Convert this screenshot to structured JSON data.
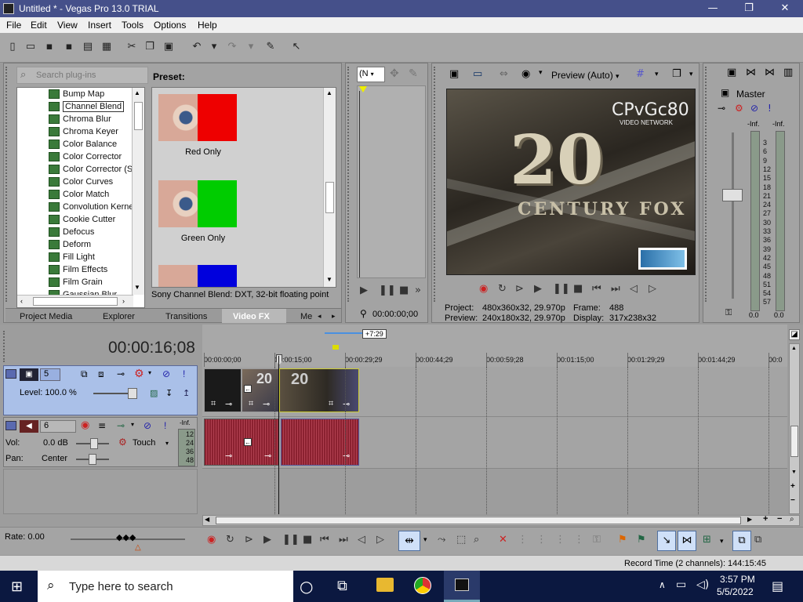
{
  "window": {
    "title": "Untitled * - Vegas Pro 13.0 TRIAL",
    "minimize": "—",
    "restore": "❐",
    "close": "✕"
  },
  "menu": [
    "File",
    "Edit",
    "View",
    "Insert",
    "Tools",
    "Options",
    "Help"
  ],
  "plugins": {
    "search_placeholder": "Search plug-ins",
    "items": [
      "Bump Map",
      "Channel Blend",
      "Chroma Blur",
      "Chroma Keyer",
      "Color Balance",
      "Color Corrector",
      "Color Corrector (S",
      "Color Curves",
      "Color Match",
      "Convolution Kerne",
      "Cookie Cutter",
      "Defocus",
      "Deform",
      "Fill Light",
      "Film Effects",
      "Film Grain",
      "Gaussian Blur"
    ],
    "selected_index": 1
  },
  "preset": {
    "header": "Preset:",
    "items": [
      "Red Only",
      "Green Only"
    ],
    "status": "Sony Channel Blend: DXT, 32-bit floating point"
  },
  "tabs": [
    "Project Media",
    "Explorer",
    "Transitions",
    "Video FX",
    "Me"
  ],
  "trimmer": {
    "dropdown": "(N",
    "timecode": "00:00:00;00"
  },
  "preview": {
    "mode_label": "Preview (Auto)",
    "watermark_title": "CPvGc80",
    "watermark_sub": "VIDEO NETWORK",
    "frame_text_main": "20",
    "frame_text_sub": "CENTURY FOX",
    "info": {
      "project_label": "Project:",
      "project_value": "480x360x32, 29.970p",
      "frame_label": "Frame:",
      "frame_value": "488",
      "preview_label": "Preview:",
      "preview_value": "240x180x32, 29.970p",
      "display_label": "Display:",
      "display_value": "317x238x32"
    }
  },
  "master": {
    "label": "Master",
    "inf_left": "-Inf.",
    "inf_right": "-Inf.",
    "scale": [
      "3",
      "6",
      "9",
      "12",
      "15",
      "18",
      "21",
      "24",
      "27",
      "30",
      "33",
      "36",
      "39",
      "42",
      "45",
      "48",
      "51",
      "54",
      "57"
    ],
    "bottom_left": "0.0",
    "bottom_right": "0.0"
  },
  "timeline": {
    "cursor_time": "00:00:16;08",
    "region_badge": "+7:29",
    "ruler": [
      "00:00:00;00",
      "00:00:15;00",
      "00:00:29;29",
      "00:00:44;29",
      "00:00:59;28",
      "00:01:15;00",
      "00:01:29;29",
      "00:01:44;29",
      "00:0"
    ],
    "video_track": {
      "number": "5",
      "level_label": "Level: 100.0 %"
    },
    "audio_track": {
      "number": "6",
      "vol_label": "Vol:",
      "vol_value": "0.0 dB",
      "pan_label": "Pan:",
      "pan_value": "Center",
      "automation": "Touch",
      "meter_inf": "-Inf.",
      "meter_scale": [
        "12",
        "24",
        "36",
        "48"
      ]
    }
  },
  "transport": {
    "rate_label": "Rate: 0.00"
  },
  "status": {
    "record_time": "Record Time (2 channels): 144:15:45"
  },
  "taskbar": {
    "search_placeholder": "Type here to search",
    "time": "3:57 PM",
    "date": "5/5/2022"
  },
  "colors": {
    "titlebar": "#45508a",
    "taskbar": "#0b1840",
    "audio_clip": "#8b2130",
    "video_track_header": "#aac0e8"
  }
}
